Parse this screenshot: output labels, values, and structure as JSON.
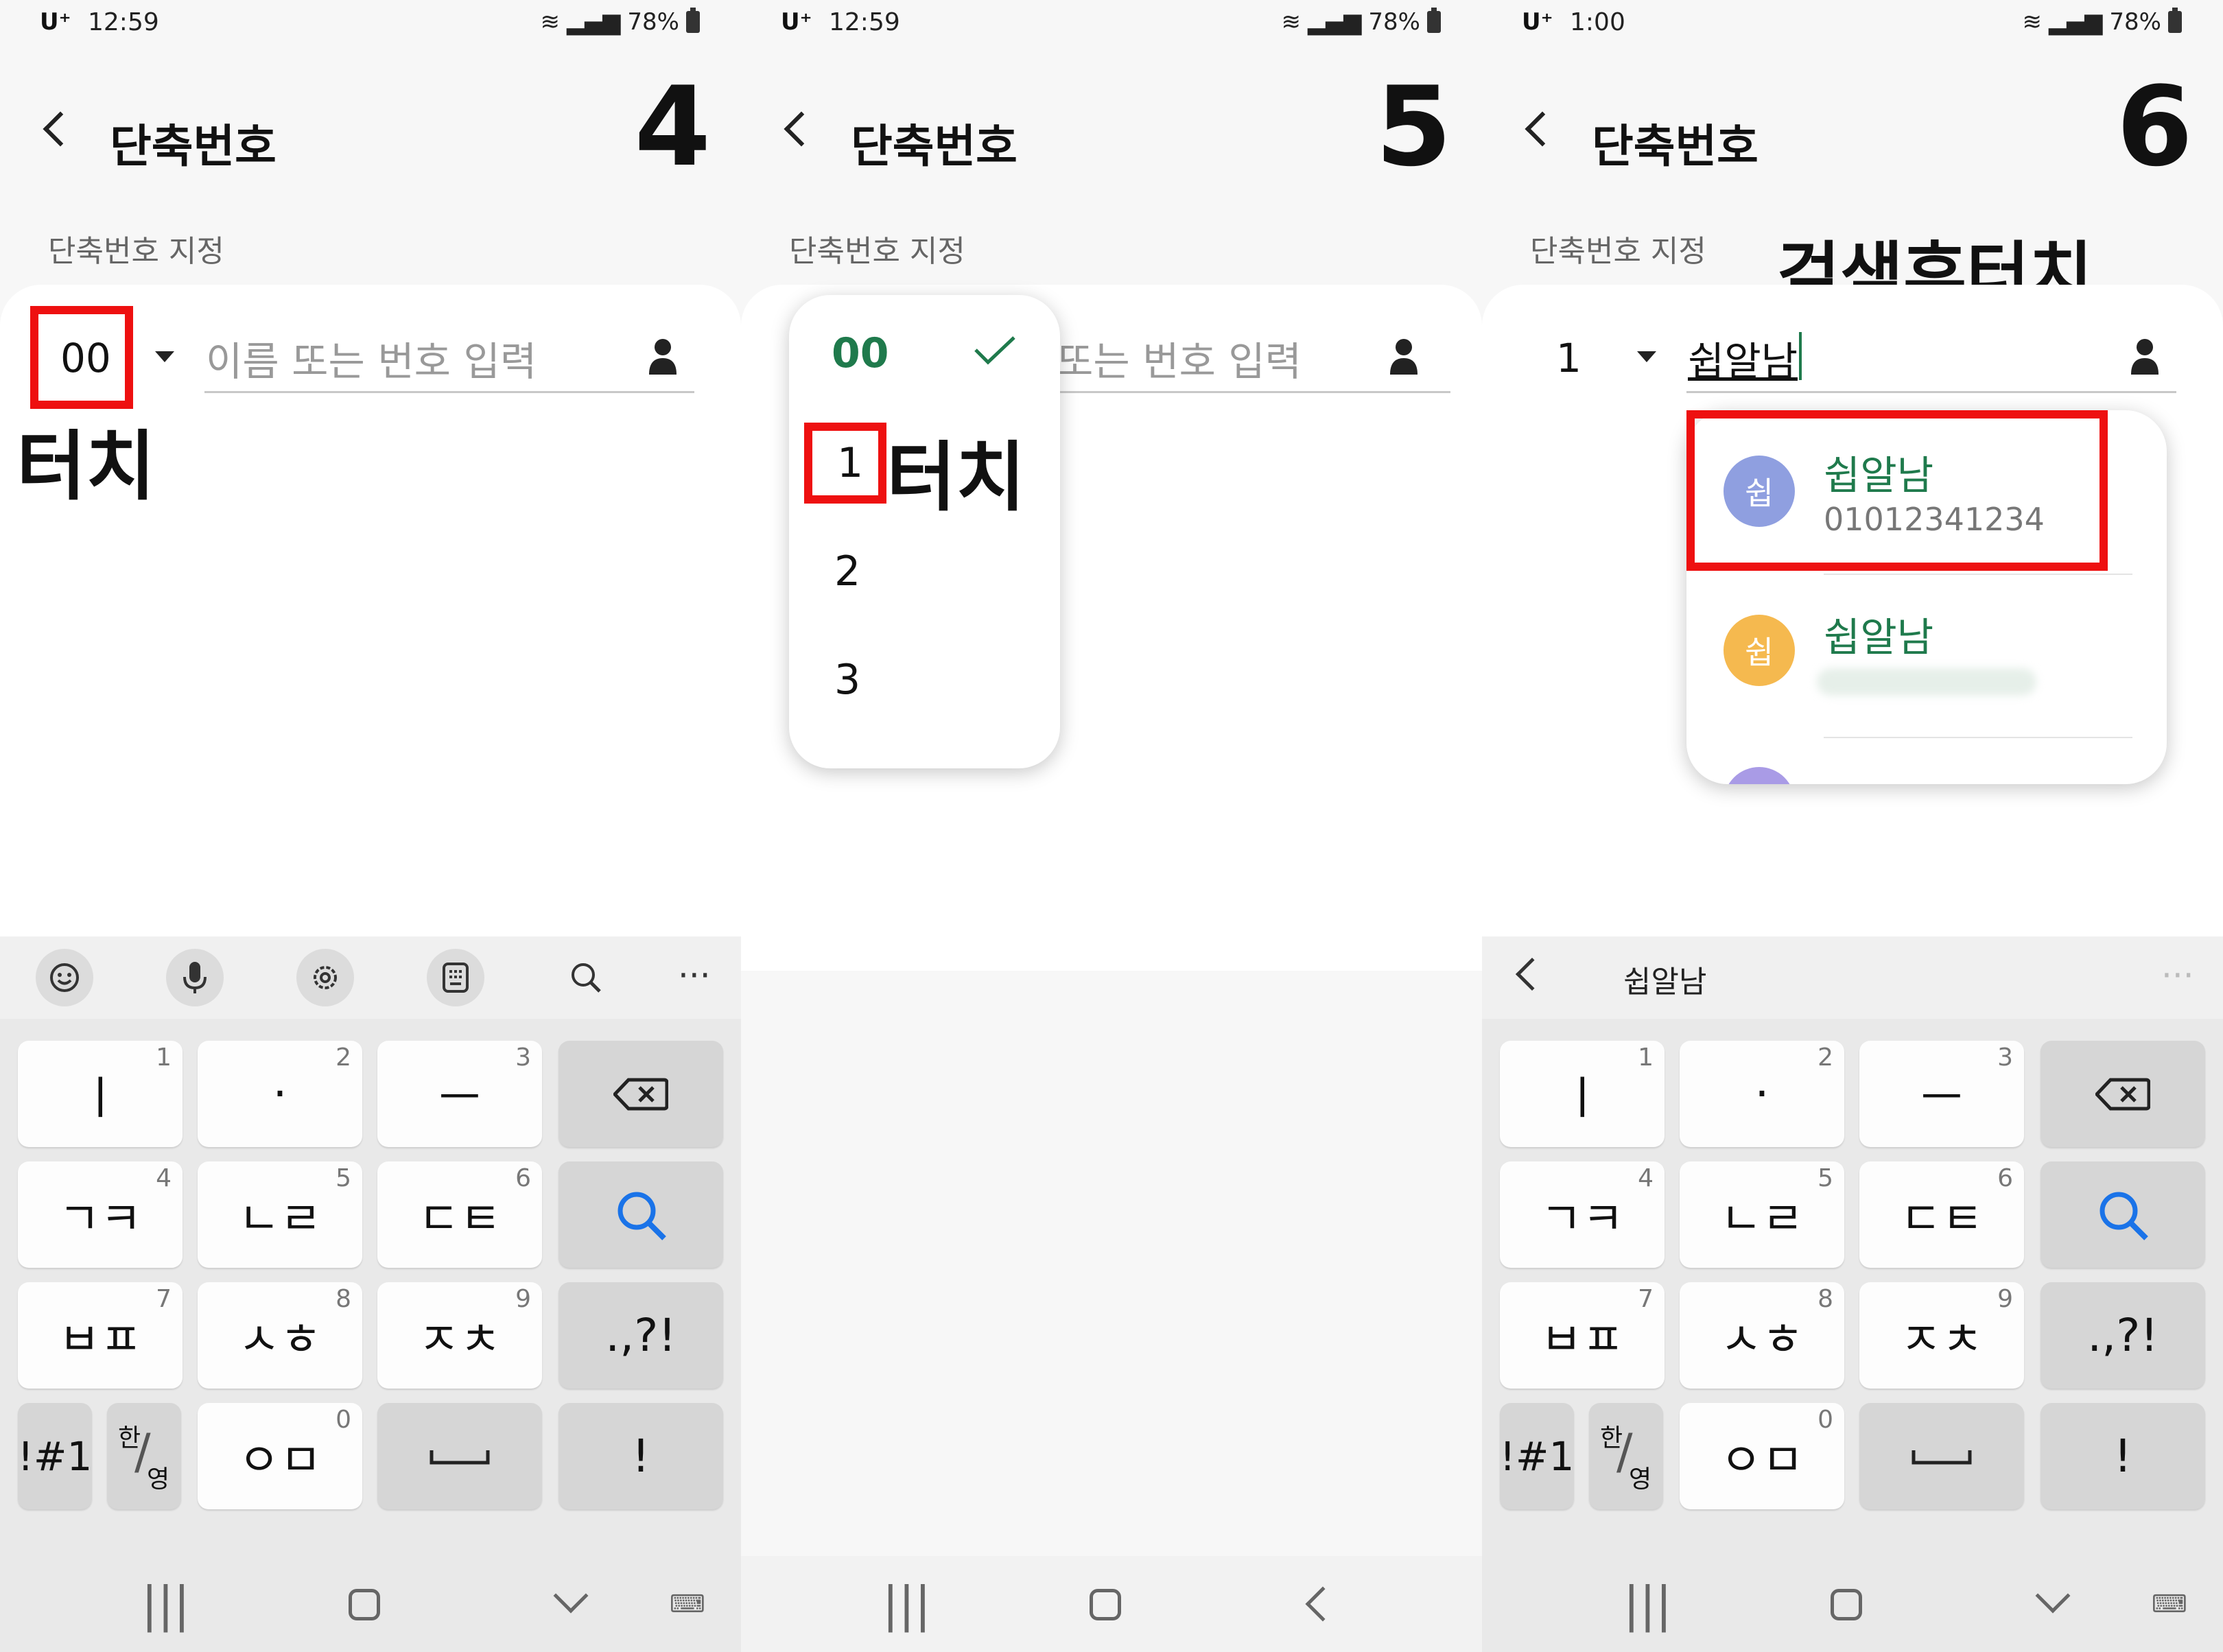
{
  "status": {
    "carrier": "U⁺",
    "battery": "78%",
    "times": [
      "12:59",
      "12:59",
      "1:00"
    ]
  },
  "screen": {
    "title": "단축번호",
    "section_label": "단축번호 지정",
    "input_placeholder": "이름 또는 번호 입력",
    "input_placeholder_partial": "또는 번호 입력"
  },
  "steps": [
    "4",
    "5",
    "6"
  ],
  "panel4": {
    "speed_dial_value": "00",
    "annotation": "터치"
  },
  "panel5": {
    "options": [
      "00",
      "1",
      "2",
      "3"
    ],
    "annotation": "터치"
  },
  "panel6": {
    "speed_dial_value": "1",
    "search_value": "쉽알남",
    "annotation": "검색후터치",
    "suggestions": [
      {
        "avatar": "쉽",
        "name": "쉽알남",
        "number": "01012341234",
        "color": "#8f9fe0"
      },
      {
        "avatar": "쉽",
        "name": "쉽알남",
        "number": "",
        "color": "#f5b94f"
      }
    ],
    "keyboard_preview": "쉽알남"
  },
  "keyboard": {
    "rows": [
      [
        {
          "label": "ㅣ",
          "num": "1"
        },
        {
          "label": "·",
          "num": "2"
        },
        {
          "label": "ㅡ",
          "num": "3"
        }
      ],
      [
        {
          "label": "ㄱㅋ",
          "num": "4"
        },
        {
          "label": "ㄴㄹ",
          "num": "5"
        },
        {
          "label": "ㄷㅌ",
          "num": "6"
        }
      ],
      [
        {
          "label": "ㅂㅍ",
          "num": "7"
        },
        {
          "label": "ㅅㅎ",
          "num": "8"
        },
        {
          "label": "ㅈㅊ",
          "num": "9"
        }
      ]
    ],
    "punct": ".,?!",
    "sym": "!#1",
    "lang_top": "한",
    "lang_bottom": "영",
    "zero_label": "ㅇㅁ",
    "zero_num": "0",
    "exclaim": "!"
  },
  "colors": {
    "accent_green": "#1f7a4c",
    "highlight_red": "#ee1010",
    "search_blue": "#1a73e8"
  }
}
